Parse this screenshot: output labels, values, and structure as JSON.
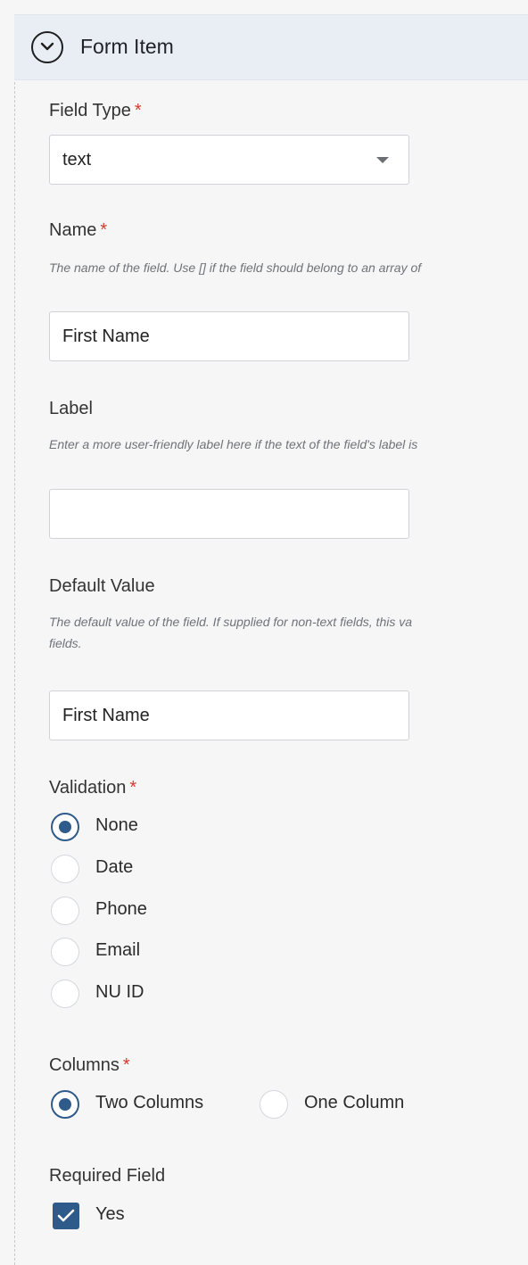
{
  "header": {
    "title": "Form Item",
    "toggle_icon": "chevron-down-circle-icon"
  },
  "field_type": {
    "label": "Field Type",
    "required_mark": "*",
    "value": "text"
  },
  "name": {
    "label": "Name",
    "required_mark": "*",
    "help": "The name of the field. Use [] if the field should belong to an array of",
    "value": "First Name"
  },
  "label_field": {
    "label": "Label",
    "help": "Enter a more user-friendly label here if the text of the field's label is",
    "value": ""
  },
  "default_value": {
    "label": "Default Value",
    "help_line1": "The default value of the field. If supplied for non-text fields, this va",
    "help_line2": "fields.",
    "value": "First Name"
  },
  "validation": {
    "label": "Validation",
    "required_mark": "*",
    "options": [
      "None",
      "Date",
      "Phone",
      "Email",
      "NU ID"
    ],
    "selected": "None"
  },
  "columns": {
    "label": "Columns",
    "required_mark": "*",
    "options": [
      "Two Columns",
      "One Column"
    ],
    "selected": "Two Columns"
  },
  "required_field": {
    "label": "Required Field",
    "option": "Yes",
    "checked": true
  },
  "colors": {
    "accent": "#2e5b8a",
    "required": "#d33b2c",
    "header_bg": "#e9eef5"
  }
}
